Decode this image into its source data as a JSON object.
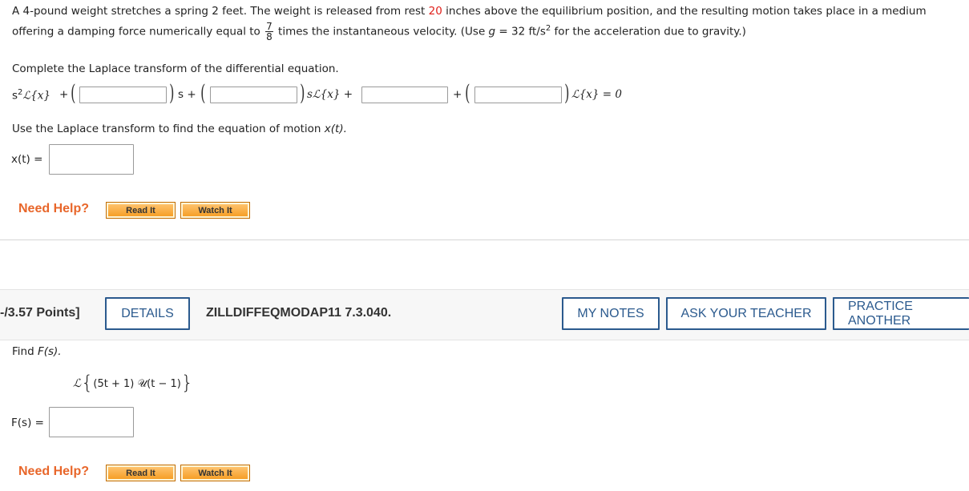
{
  "problem1": {
    "line1_a": "A 4-pound weight stretches a spring 2 feet. The weight is released from rest ",
    "line1_red": "20",
    "line1_b": " inches above the equilibrium position, and the resulting motion takes place in a medium",
    "line2_a": "offering a damping force numerically equal to",
    "frac_num": "7",
    "frac_den": "8",
    "line2_b": "times the instantaneous velocity. (Use ",
    "g_var": "g",
    "g_eq": " = 32 ft/s",
    "g_exp": "2",
    "line2_c": " for the acceleration due to gravity.)",
    "part1_prompt": "Complete the Laplace transform of the differential equation.",
    "eq_s2": "s",
    "eq_s2_exp": "2",
    "eq_Lx": "ℒ{x}",
    "eq_plus": "+",
    "eq_s_plus": "s +",
    "eq_sLx_plus": "sℒ{x} +",
    "eq_Lx_eq0": "ℒ{x} = 0",
    "part2_prompt_a": "Use the Laplace transform to find the equation of motion ",
    "part2_prompt_b": "x(t).",
    "xt_label": "x(t) ="
  },
  "help": {
    "label": "Need Help?",
    "read_it": "Read It",
    "watch_it": "Watch It"
  },
  "problem2_header": {
    "points": "-/3.57 Points]",
    "details": "DETAILS",
    "problem_id": "ZILLDIFFEQMODAP11 7.3.040.",
    "my_notes": "MY NOTES",
    "ask_teacher": "ASK YOUR TEACHER",
    "practice_another": "PRACTICE ANOTHER"
  },
  "problem2": {
    "prompt_a": "Find ",
    "prompt_b": "F(s).",
    "expr_L": "ℒ",
    "expr_body": "(5t + 1) 𝒰(t − 1)",
    "fs_label": "F(s) ="
  },
  "colors": {
    "accent_red": "#e0201b",
    "help_orange": "#e8662a",
    "button_blue": "#2b5a8e"
  }
}
